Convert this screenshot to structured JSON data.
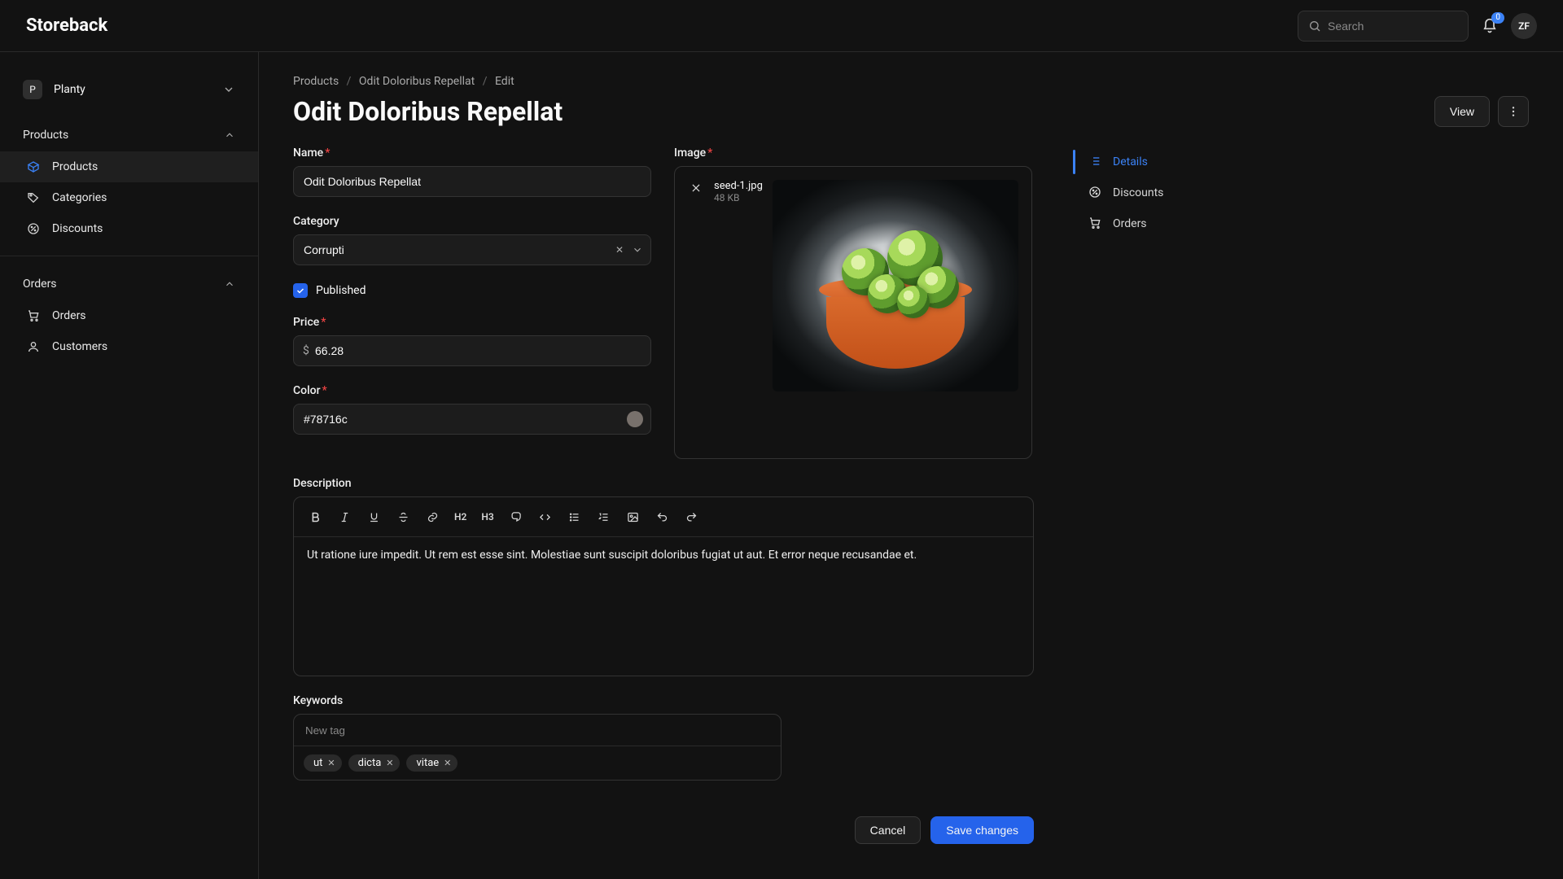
{
  "brand": "Storeback",
  "topbar": {
    "search_placeholder": "Search",
    "notifications_count": "0",
    "avatar_initials": "ZF"
  },
  "tenant": {
    "badge": "P",
    "name": "Planty"
  },
  "sidebar": {
    "products_section": "Products",
    "orders_section": "Orders",
    "items": {
      "products": "Products",
      "categories": "Categories",
      "discounts": "Discounts",
      "orders": "Orders",
      "customers": "Customers"
    }
  },
  "breadcrumb": {
    "a": "Products",
    "b": "Odit Doloribus Repellat",
    "c": "Edit"
  },
  "page": {
    "title": "Odit Doloribus Repellat",
    "view_btn": "View"
  },
  "form": {
    "name_label": "Name",
    "name_value": "Odit Doloribus Repellat",
    "category_label": "Category",
    "category_value": "Corrupti",
    "published_label": "Published",
    "price_label": "Price",
    "price_currency": "$",
    "price_value": "66.28",
    "color_label": "Color",
    "color_value": "#78716c",
    "image_label": "Image",
    "image_filename": "seed-1.jpg",
    "image_filesize": "48 KB",
    "description_label": "Description",
    "description_text": "Ut ratione iure impedit. Ut rem est esse sint. Molestiae sunt suscipit doloribus fugiat ut aut. Et error neque recusandae et.",
    "keywords_label": "Keywords",
    "keywords_placeholder": "New tag",
    "keywords": [
      "ut",
      "dicta",
      "vitae"
    ]
  },
  "editor_toolbar": {
    "h2": "H2",
    "h3": "H3"
  },
  "right_tabs": {
    "details": "Details",
    "discounts": "Discounts",
    "orders": "Orders"
  },
  "footer": {
    "cancel": "Cancel",
    "save": "Save changes"
  },
  "colors": {
    "accent": "#2563eb",
    "swatch": "#78716c"
  }
}
